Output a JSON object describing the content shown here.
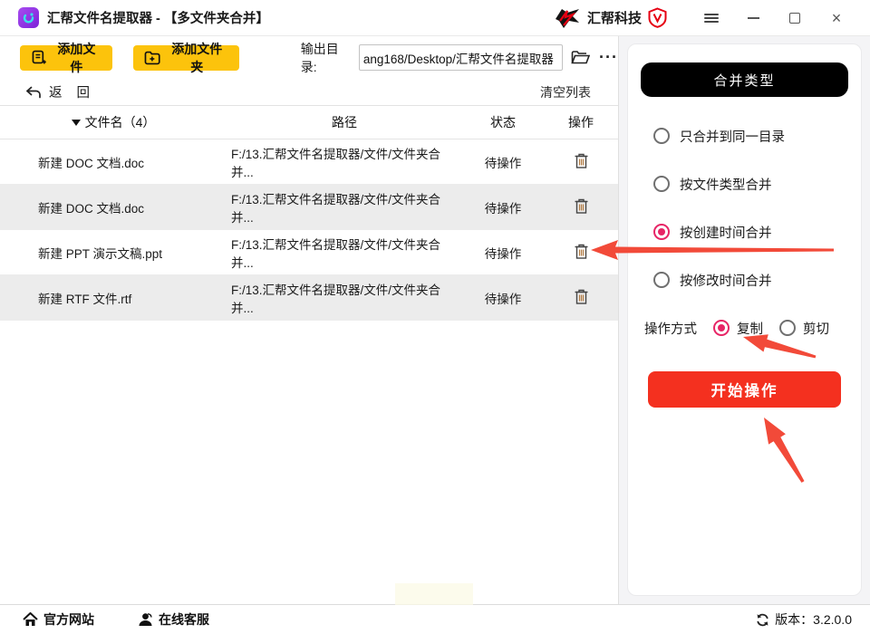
{
  "titlebar": {
    "title": "汇帮文件名提取器 - 【多文件夹合并】",
    "brand": "汇帮科技"
  },
  "toolbar": {
    "add_file": "添加文件",
    "add_folder": "添加文件夹",
    "output_label": "输出目录:",
    "output_value": "ang168/Desktop/汇帮文件名提取器",
    "more": "···"
  },
  "listbar": {
    "back": "返 回",
    "clear": "清空列表"
  },
  "table": {
    "headers": {
      "name": "文件名（4）",
      "path": "路径",
      "status": "状态",
      "action": "操作"
    },
    "rows": [
      {
        "name": "新建 DOC 文档.doc",
        "path": "F:/13.汇帮文件名提取器/文件/文件夹合并...",
        "status": "待操作"
      },
      {
        "name": "新建 DOC 文档.doc",
        "path": "F:/13.汇帮文件名提取器/文件/文件夹合并...",
        "status": "待操作"
      },
      {
        "name": "新建 PPT 演示文稿.ppt",
        "path": "F:/13.汇帮文件名提取器/文件/文件夹合并...",
        "status": "待操作"
      },
      {
        "name": "新建 RTF 文件.rtf",
        "path": "F:/13.汇帮文件名提取器/文件/文件夹合并...",
        "status": "待操作"
      }
    ]
  },
  "panel": {
    "header": "合并类型",
    "options": [
      {
        "label": "只合并到同一目录",
        "selected": false
      },
      {
        "label": "按文件类型合并",
        "selected": false
      },
      {
        "label": "按创建时间合并",
        "selected": true
      },
      {
        "label": "按修改时间合并",
        "selected": false
      }
    ],
    "mode_label": "操作方式",
    "modes": [
      {
        "label": "复制",
        "selected": true
      },
      {
        "label": "剪切",
        "selected": false
      }
    ],
    "start_button": "开始操作"
  },
  "footer": {
    "website": "官方网站",
    "support": "在线客服",
    "version": "版本：3.2.0.0"
  },
  "colors": {
    "accent_yellow": "#fcc30c",
    "accent_red": "#f4301f",
    "radio_selected": "#e72566",
    "annotation_arrow": "#f24a39",
    "row_alt": "#ececec",
    "panel_bg": "#f4f4f6"
  }
}
